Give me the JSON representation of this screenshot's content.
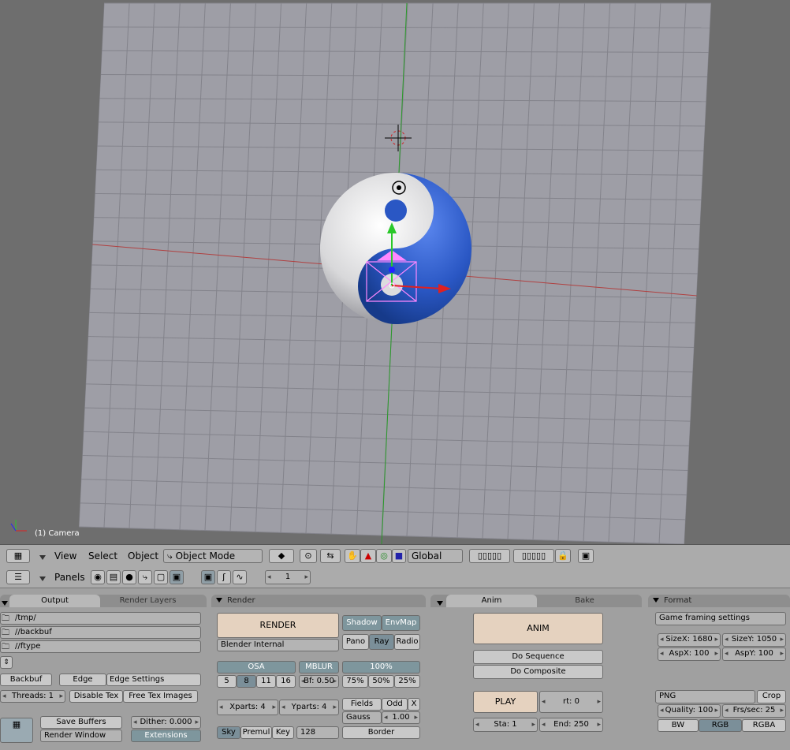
{
  "viewport": {
    "object_label": "(1) Camera"
  },
  "header3d": {
    "menu_view": "View",
    "menu_select": "Select",
    "menu_object": "Object",
    "mode_value": "Object Mode",
    "orientation_value": "Global"
  },
  "buttons_header": {
    "panels_label": "Panels",
    "frame_value": "1"
  },
  "output_panel": {
    "tabs": [
      "Output",
      "Render Layers"
    ],
    "paths": [
      "/tmp/",
      "//backbuf",
      "//ftype"
    ],
    "backbuf": "Backbuf",
    "edge": "Edge",
    "edge_settings": "Edge Settings",
    "threads": "Threads: 1",
    "disable_tex": "Disable Tex",
    "free_tex_images": "Free Tex Images",
    "save_buffers": "Save Buffers",
    "dither": "Dither: 0.000",
    "render_window": "Render Window",
    "extensions": "Extensions"
  },
  "render_panel": {
    "title": "Render",
    "render_button": "RENDER",
    "engine": "Blender Internal",
    "shadow": "Shadow",
    "envmap": "EnvMap",
    "pano": "Pano",
    "ray": "Ray",
    "radio": "Radio",
    "osa": "OSA",
    "osa_levels": [
      "5",
      "8",
      "11",
      "16"
    ],
    "mblur": "MBLUR",
    "bf": "Bf: 0.50",
    "percent": "100%",
    "percent_options": [
      "75%",
      "50%",
      "25%"
    ],
    "xparts": "Xparts: 4",
    "yparts": "Yparts: 4",
    "fields": "Fields",
    "odd": "Odd",
    "x": "X",
    "gauss": "Gauss",
    "gauss_value": "1.00",
    "sky": "Sky",
    "premul": "Premul",
    "key": "Key",
    "size_128": "128",
    "border": "Border"
  },
  "anim_panel": {
    "tabs": [
      "Anim",
      "Bake"
    ],
    "anim_button": "ANIM",
    "do_sequence": "Do Sequence",
    "do_composite": "Do Composite",
    "play": "PLAY",
    "rt": "rt: 0",
    "sta": "Sta: 1",
    "end": "End: 250"
  },
  "format_panel": {
    "title": "Format",
    "preset": "Game framing settings",
    "sizex": "SizeX: 1680",
    "sizey": "SizeY: 1050",
    "aspx": "AspX: 100",
    "aspy": "AspY: 100",
    "file_type": "PNG",
    "crop": "Crop",
    "quality": "Quality: 100",
    "fps": "Frs/sec: 25",
    "bw": "BW",
    "rgb": "RGB",
    "rgba": "RGBA"
  },
  "colors": {
    "grid_bg": "#9e9ea6",
    "yin_blue": "#2a57c4",
    "yang_white": "#dcdcde",
    "selection_pink": "#ff88ff"
  }
}
